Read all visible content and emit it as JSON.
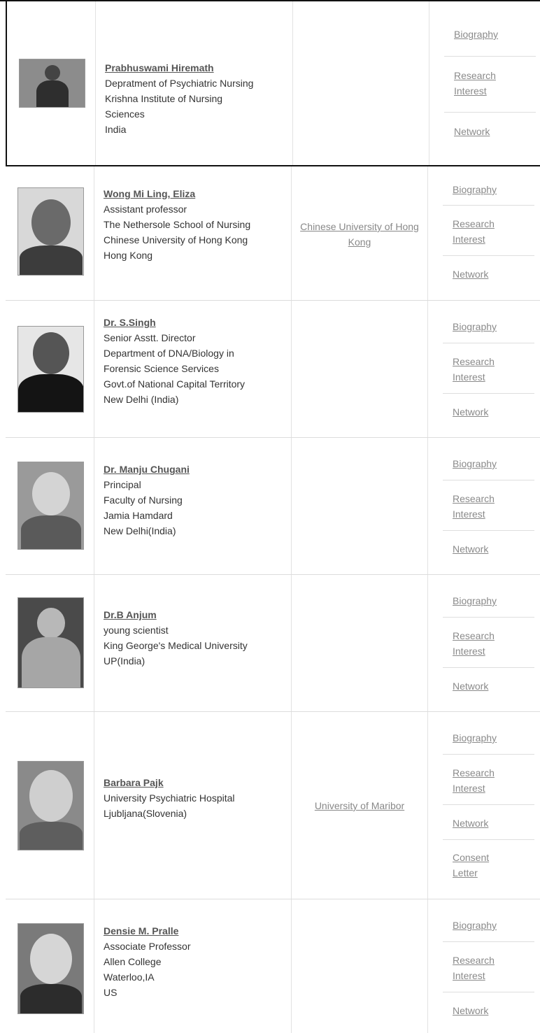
{
  "people": [
    {
      "name": "Prabhuswami Hiremath",
      "lines": [
        "Depratment of Psychiatric Nursing",
        "Krishna Institute of Nursing",
        "Sciences",
        "India"
      ],
      "university": "",
      "links": [
        "Biography",
        "Research Interest",
        "Network"
      ]
    },
    {
      "name": "Wong Mi Ling, Eliza",
      "lines": [
        "Assistant professor",
        "The Nethersole School of Nursing",
        "Chinese University of Hong Kong",
        "Hong Kong"
      ],
      "university": "Chinese University of Hong Kong",
      "links": [
        "Biography",
        "Research Interest",
        "Network"
      ]
    },
    {
      "name": "Dr. S.Singh",
      "lines": [
        "Senior Asstt. Director",
        "Department of DNA/Biology in",
        "Forensic Science Services",
        "Govt.of National Capital Territory",
        "New Delhi (India)"
      ],
      "university": "",
      "links": [
        "Biography",
        "Research Interest",
        "Network"
      ]
    },
    {
      "name": "Dr. Manju Chugani",
      "lines": [
        "Principal",
        "Faculty of Nursing",
        "Jamia Hamdard",
        "New Delhi(India)"
      ],
      "university": "",
      "links": [
        "Biography",
        "Research Interest",
        "Network"
      ]
    },
    {
      "name": "Dr.B Anjum",
      "lines": [
        "young scientist",
        "King George's Medical University",
        "UP(India)"
      ],
      "university": "",
      "links": [
        "Biography",
        "Research Interest",
        "Network"
      ]
    },
    {
      "name": "Barbara Pajk",
      "lines": [
        "University Psychiatric Hospital",
        "Ljubljana(Slovenia)"
      ],
      "university": "University of Maribor",
      "links": [
        "Biography",
        "Research Interest",
        "Network",
        "Consent Letter"
      ]
    },
    {
      "name": "Densie M. Pralle",
      "lines": [
        "Associate Professor",
        "Allen College",
        "Waterloo,IA",
        "US"
      ],
      "university": "",
      "links": [
        "Biography",
        "Research Interest",
        "Network"
      ]
    }
  ]
}
